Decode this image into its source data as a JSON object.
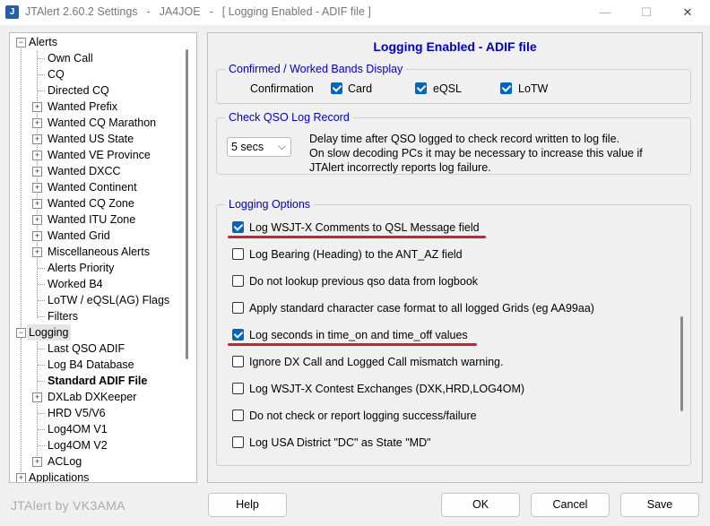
{
  "window": {
    "title_parts": [
      "JTAlert 2.60.2 Settings",
      "-",
      "JA4JOE",
      "-",
      "[ Logging Enabled - ADIF file ]"
    ],
    "minimize": "—",
    "maximize": "☐",
    "close": "✕"
  },
  "tree": {
    "items": [
      {
        "label": "Alerts"
      },
      {
        "label": "Own Call"
      },
      {
        "label": "CQ"
      },
      {
        "label": "Directed CQ"
      },
      {
        "label": "Wanted Prefix"
      },
      {
        "label": "Wanted CQ Marathon"
      },
      {
        "label": "Wanted US State"
      },
      {
        "label": "Wanted VE Province"
      },
      {
        "label": "Wanted DXCC"
      },
      {
        "label": "Wanted Continent"
      },
      {
        "label": "Wanted CQ Zone"
      },
      {
        "label": "Wanted ITU Zone"
      },
      {
        "label": "Wanted Grid"
      },
      {
        "label": "Miscellaneous Alerts"
      },
      {
        "label": "Alerts Priority"
      },
      {
        "label": "Worked B4"
      },
      {
        "label": "LoTW / eQSL(AG) Flags"
      },
      {
        "label": "Filters"
      },
      {
        "label": "Logging"
      },
      {
        "label": "Last QSO ADIF"
      },
      {
        "label": "Log B4 Database"
      },
      {
        "label": "Standard ADIF File"
      },
      {
        "label": "DXLab DXKeeper"
      },
      {
        "label": "HRD V5/V6"
      },
      {
        "label": "Log4OM V1"
      },
      {
        "label": "Log4OM V2"
      },
      {
        "label": "ACLog"
      },
      {
        "label": "Applications"
      }
    ]
  },
  "panel": {
    "title": "Logging Enabled - ADIF file",
    "confirmed": {
      "title": "Confirmed / Worked Bands Display",
      "label": "Confirmation",
      "card": {
        "label": "Card",
        "checked": true
      },
      "eqsl": {
        "label": "eQSL",
        "checked": true
      },
      "lotw": {
        "label": "LoTW",
        "checked": true
      }
    },
    "check_qso": {
      "title": "Check QSO Log Record",
      "select_value": "5 secs",
      "desc1": "Delay time after QSO logged to check record written to log file.",
      "desc2": "On slow decoding PCs it may be necessary to increase this value if",
      "desc3": "JTAlert incorrectly reports log failure."
    },
    "logging_options": {
      "title": "Logging Options",
      "options": [
        {
          "label": "Log WSJT-X Comments to QSL Message field",
          "checked": true
        },
        {
          "label": "Log Bearing (Heading) to the ANT_AZ field",
          "checked": false
        },
        {
          "label": "Do not lookup previous qso data from logbook",
          "checked": false
        },
        {
          "label": "Apply standard character case format to all logged Grids (eg AA99aa)",
          "checked": false
        },
        {
          "label": "Log seconds in time_on and time_off values",
          "checked": true
        },
        {
          "label": "Ignore DX Call and Logged Call mismatch warning.",
          "checked": false
        },
        {
          "label": "Log WSJT-X Contest Exchanges (DXK,HRD,LOG4OM)",
          "checked": false
        },
        {
          "label": "Do not check or report logging success/failure",
          "checked": false
        },
        {
          "label": "Log USA District \"DC\" as State \"MD\"",
          "checked": false
        }
      ]
    }
  },
  "footer": {
    "credit": "JTAlert by VK3AMA",
    "help": "Help",
    "ok": "OK",
    "cancel": "Cancel",
    "save": "Save"
  },
  "colors": {
    "accent_blue": "#0000cc",
    "checkbox_blue": "#0067c0",
    "highlight_red": "#e0182d"
  }
}
